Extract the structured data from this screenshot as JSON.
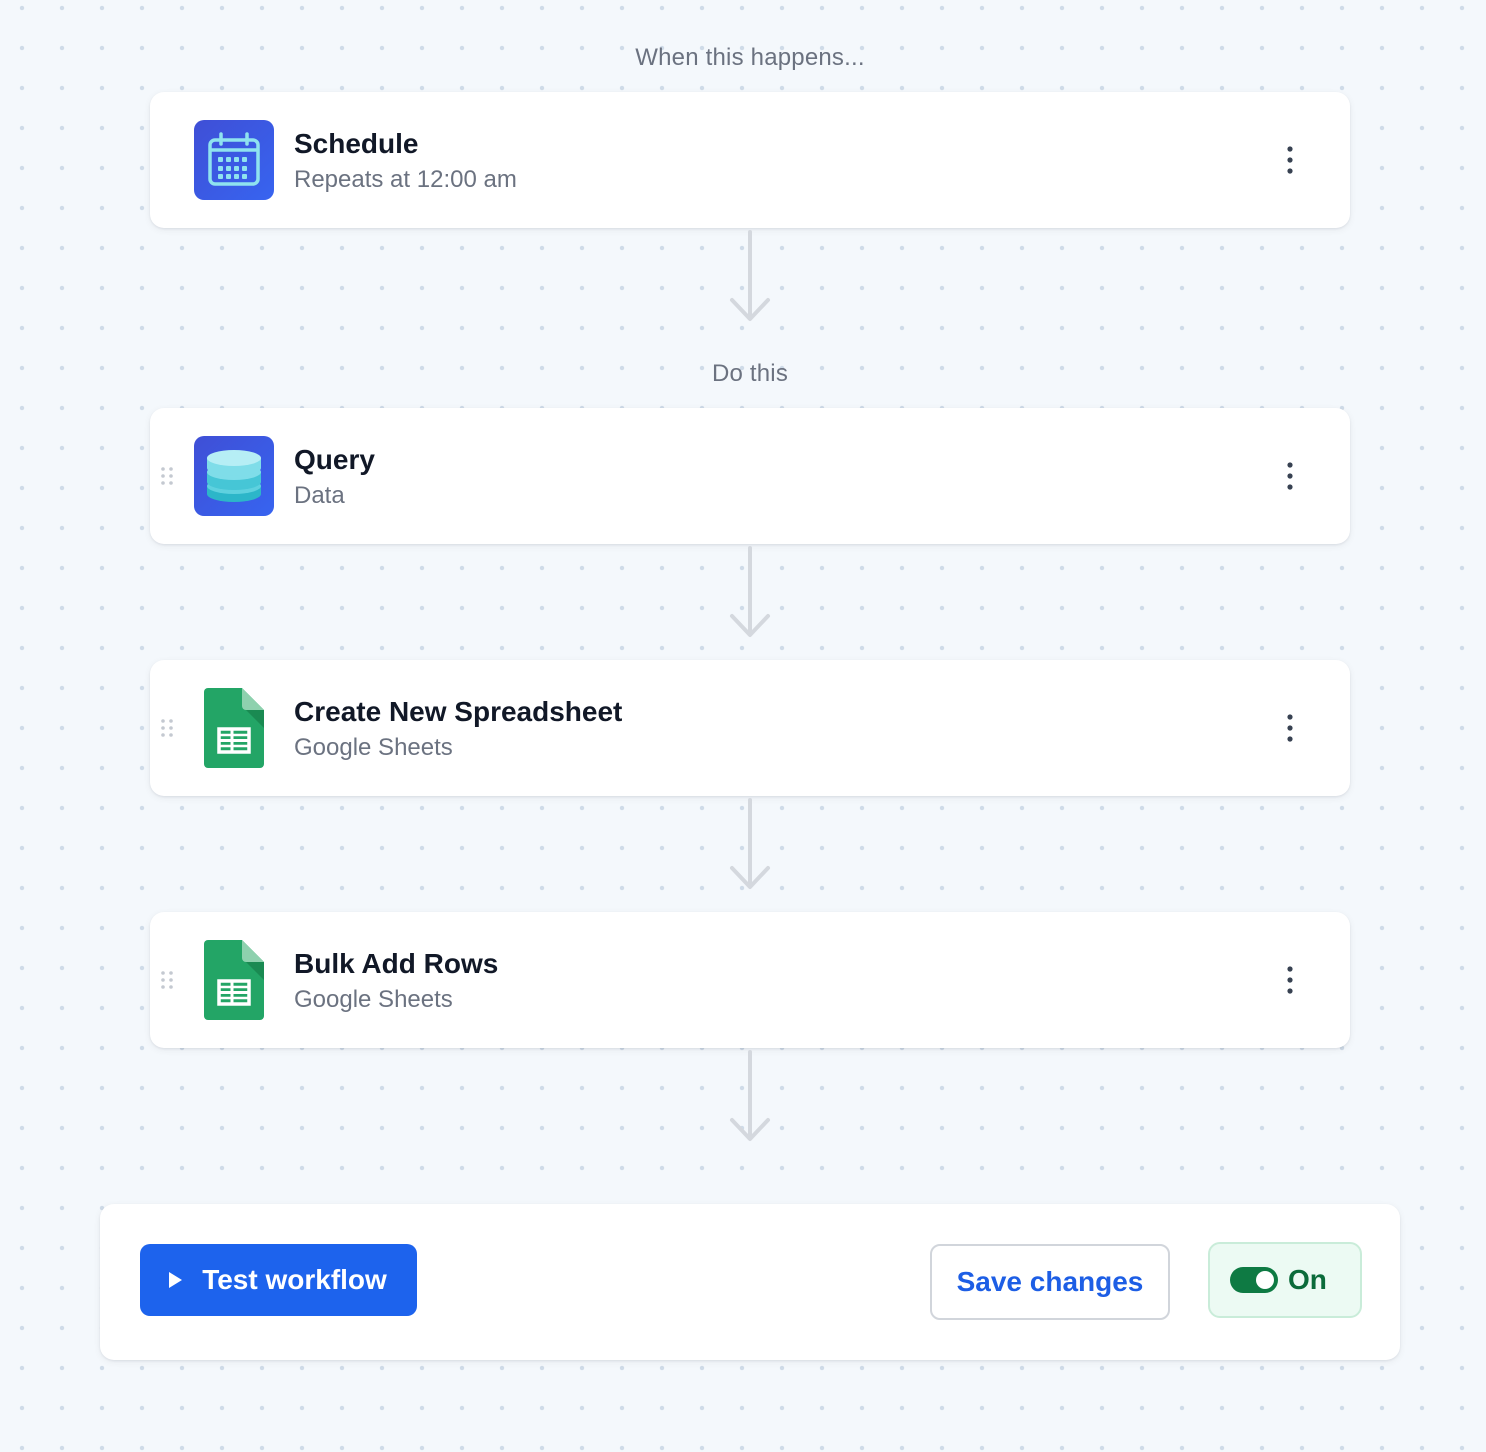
{
  "trigger_section": {
    "label": "When this happens..."
  },
  "actions_section": {
    "label": "Do this"
  },
  "steps": [
    {
      "title": "Schedule",
      "subtitle": "Repeats at 12:00 am",
      "icon": "calendar-icon",
      "icon_bg": "#3b55e6"
    },
    {
      "title": "Query",
      "subtitle": "Data",
      "icon": "database-icon",
      "icon_bg": "#3b55e6"
    },
    {
      "title": "Create New Spreadsheet",
      "subtitle": "Google Sheets",
      "icon": "google-sheets-icon",
      "icon_bg": "#23a566"
    },
    {
      "title": "Bulk Add Rows",
      "subtitle": "Google Sheets",
      "icon": "google-sheets-icon",
      "icon_bg": "#23a566"
    }
  ],
  "footer": {
    "test_label": "Test workflow",
    "save_label": "Save changes",
    "toggle_label": "On",
    "toggle_on": true
  },
  "colors": {
    "primary": "#1d63ed",
    "toggle_on": "#0e7a43",
    "connector": "#d4d8de"
  }
}
